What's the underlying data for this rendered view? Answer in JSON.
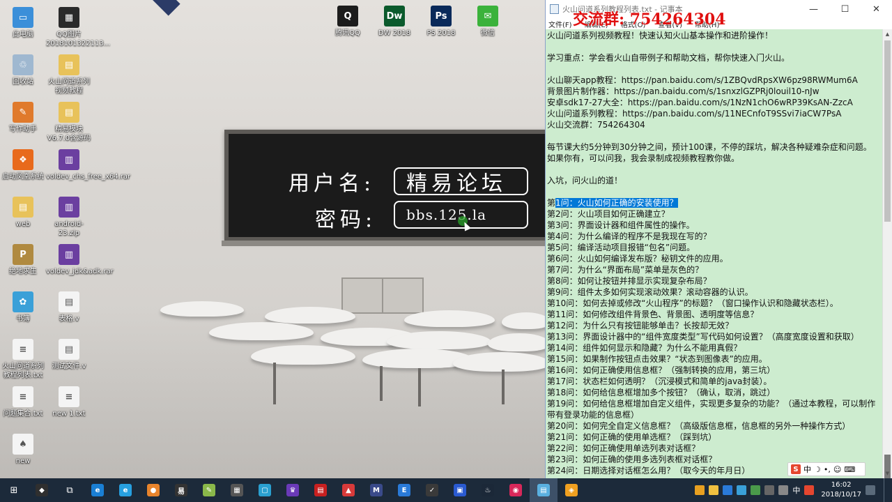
{
  "desktop": {
    "icons": [
      {
        "label": "此电脑",
        "color": "#3b8fd9",
        "glyph": "▭"
      },
      {
        "label": "QQ图片2018101322113...",
        "color": "#2a2a2a",
        "glyph": "▦"
      },
      {
        "label": "回收站",
        "color": "#9fb8d0",
        "glyph": "♲"
      },
      {
        "label": "火山问道系列视频教程",
        "color": "#e8c25a",
        "glyph": "▤"
      },
      {
        "label": "写作助手",
        "color": "#e07a2c",
        "glyph": "✎"
      },
      {
        "label": "精易模块V6.7.0含源码",
        "color": "#e8c25a",
        "glyph": "▤"
      },
      {
        "label": "启动凤凰系统",
        "color": "#e86a1c",
        "glyph": "❖"
      },
      {
        "label": "voldev_chs_free_x64.rar",
        "color": "#6b3fa0",
        "glyph": "▥"
      },
      {
        "label": "web",
        "color": "#e8c25a",
        "glyph": "▤"
      },
      {
        "label": "android-23.zip",
        "color": "#6b3fa0",
        "glyph": "▥"
      },
      {
        "label": "绝地求生",
        "color": "#b08a40",
        "glyph": "P"
      },
      {
        "label": "voldev_jdk&adk.rar",
        "color": "#6b3fa0",
        "glyph": "▥"
      },
      {
        "label": "书簿",
        "color": "#3aa0d8",
        "glyph": "✿"
      },
      {
        "label": "表格.v",
        "color": "#f4f4f4",
        "glyph": "▤"
      },
      {
        "label": "火山问道系列教程列表.txt",
        "color": "#f4f4f4",
        "glyph": "≡"
      },
      {
        "label": "测试文件.v",
        "color": "#f4f4f4",
        "glyph": "▤"
      },
      {
        "label": "问题集合.txt",
        "color": "#f4f4f4",
        "glyph": "≡"
      },
      {
        "label": "new 1.txt",
        "color": "#f4f4f4",
        "glyph": "≡"
      },
      {
        "label": "new",
        "color": "#f4f4f4",
        "glyph": "♠"
      }
    ],
    "top_icons": [
      {
        "label": "腾讯QQ",
        "color": "#1c1c1c",
        "glyph": "Q"
      },
      {
        "label": "DW 2018",
        "color": "#0b5a2c",
        "glyph": "Dw"
      },
      {
        "label": "PS 2018",
        "color": "#0a2a5a",
        "glyph": "Ps"
      },
      {
        "label": "微信",
        "color": "#3bb23b",
        "glyph": "✉"
      }
    ],
    "blackboard": {
      "username_label": "用户名:",
      "username_value": "精易论坛",
      "password_label": "密码:",
      "password_value": "bbs.125.la"
    }
  },
  "notepad": {
    "title": "火山问道系列教程列表.txt - 记事本",
    "overlay_text": "交流群: 754264304",
    "menu": [
      "文件(F)",
      "编辑(E)",
      "格式(O)",
      "查看(V)",
      "帮助(H)"
    ],
    "lines": [
      {
        "text": "火山问道系列视频教程！快速认知火山基本操作和进阶操作！"
      },
      {
        "text": ""
      },
      {
        "text": "学习重点：学会看火山自带例子和帮助文档，帮你快速入门火山。"
      },
      {
        "text": ""
      },
      {
        "text": "火山聊天app教程：https://pan.baidu.com/s/1ZBQvdRpsXW6pz98RWMum6A"
      },
      {
        "text": "背景图片制作器：https://pan.baidu.com/s/1snxzlGZPRj0louil10-nJw"
      },
      {
        "text": "安卓sdk17-27大全：https://pan.baidu.com/s/1NzN1chO6wRP39KsAN-ZzcA"
      },
      {
        "text": "火山问道系列教程：https://pan.baidu.com/s/11NECnfoT9SSvi7iaCW7PsA"
      },
      {
        "text": "火山交流群：754264304"
      },
      {
        "text": ""
      },
      {
        "text": "每节课大约5分钟到30分钟之间，预计100课，不停的踩坑，解决各种疑难杂症和问题。"
      },
      {
        "text": "如果你有，可以问我，我会录制成视频教程教你做。"
      },
      {
        "text": ""
      },
      {
        "text": "入坑，问火山的道！"
      },
      {
        "text": ""
      },
      {
        "prefix": "第",
        "selected": "1问：火山如何正确的安装使用？"
      },
      {
        "text": "第2问：火山项目如何正确建立？"
      },
      {
        "text": "第3问：界面设计器和组件属性的操作。"
      },
      {
        "text": "第4问：为什么编译的程序不是我现在写的？"
      },
      {
        "text": "第5问：编译活动项目报错“包名”问题。"
      },
      {
        "text": "第6问：火山如何编译发布版？秘钥文件的应用。"
      },
      {
        "text": "第7问：为什么“界面布局”菜单是灰色的？"
      },
      {
        "text": "第8问：如何让按钮并排显示实现复杂布局？"
      },
      {
        "text": "第9问：组件太多如何实现滚动效果？滚动容器的认识。"
      },
      {
        "text": "第10问：如何去掉或修改“火山程序”的标题？（窗口操作认识和隐藏状态栏）。"
      },
      {
        "text": "第11问：如何修改组件背景色、背景图、透明度等信息？"
      },
      {
        "text": "第12问：为什么只有按钮能够单击？长按却无效？"
      },
      {
        "text": "第13问：界面设计器中的“组件宽度类型”写代码如何设置？（高度宽度设置和获取）"
      },
      {
        "text": "第14问：组件如何显示和隐藏？为什么不能用真假？"
      },
      {
        "text": "第15问：如果制作按钮点击效果？“状态到图像表”的应用。"
      },
      {
        "text": "第16问：如何正确使用信息框？（强制转换的应用，第三坑）"
      },
      {
        "text": "第17问：状态栏如何透明？（沉浸模式和简单的java封装）。"
      },
      {
        "text": "第18问：如何给信息框增加多个按钮？（确认，取消，跳过）"
      },
      {
        "text": "第19问：如何给信息框增加自定义组件，实现更多复杂的功能？（通过本教程，可以制作带有登录功能的信息框）",
        "wrap": true
      },
      {
        "text": "第20问：如何完全自定义信息框？（高级版信息框，信息框的另外一种操作方式）"
      },
      {
        "text": "第21问：如何正确的使用单选框？（踩到坑）"
      },
      {
        "text": "第22问：如何正确使用单选列表对话框？"
      },
      {
        "text": "第23问：如何正确的使用多选列表框对话框？"
      },
      {
        "text": "第24问：日期选择对话框怎么用？（取今天的年月日）"
      }
    ],
    "ime_label": "中"
  },
  "taskbar": {
    "apps": [
      {
        "name": "start",
        "glyph": "⊞",
        "color": ""
      },
      {
        "name": "app-1",
        "glyph": "◆",
        "color": "#2f2f2f"
      },
      {
        "name": "task-view",
        "glyph": "⧉",
        "color": ""
      },
      {
        "name": "edge",
        "glyph": "e",
        "color": "#1a7fd4"
      },
      {
        "name": "ie",
        "glyph": "e",
        "color": "#27a0e0"
      },
      {
        "name": "app-2",
        "glyph": "●",
        "color": "#e8842c"
      },
      {
        "name": "app-3",
        "glyph": "易",
        "color": "#333333"
      },
      {
        "name": "notepad-plus",
        "glyph": "✎",
        "color": "#8ab84a"
      },
      {
        "name": "calculator",
        "glyph": "▦",
        "color": "#555555"
      },
      {
        "name": "app-4",
        "glyph": "▢",
        "color": "#2aa0d0"
      },
      {
        "name": "app-5",
        "glyph": "♛",
        "color": "#6a3ab8"
      },
      {
        "name": "app-6",
        "glyph": "▤",
        "color": "#c82020"
      },
      {
        "name": "app-7",
        "glyph": "▲",
        "color": "#d83a3a"
      },
      {
        "name": "app-8",
        "glyph": "M",
        "color": "#3a4a8a"
      },
      {
        "name": "app-9",
        "glyph": "E",
        "color": "#2a7ad8"
      },
      {
        "name": "app-10",
        "glyph": "✓",
        "color": "#3a3a3a"
      },
      {
        "name": "app-11",
        "glyph": "▣",
        "color": "#2a5ad0"
      },
      {
        "name": "steam",
        "glyph": "♨",
        "color": "#1b2838"
      },
      {
        "name": "app-12",
        "glyph": "◉",
        "color": "#d8285a"
      },
      {
        "name": "notepad",
        "glyph": "▤",
        "color": "#5ab0e0"
      },
      {
        "name": "app-13",
        "glyph": "◈",
        "color": "#f0a020"
      }
    ],
    "clock_time": "16:02",
    "clock_date": "2018/10/17",
    "input_indicator": "中"
  }
}
